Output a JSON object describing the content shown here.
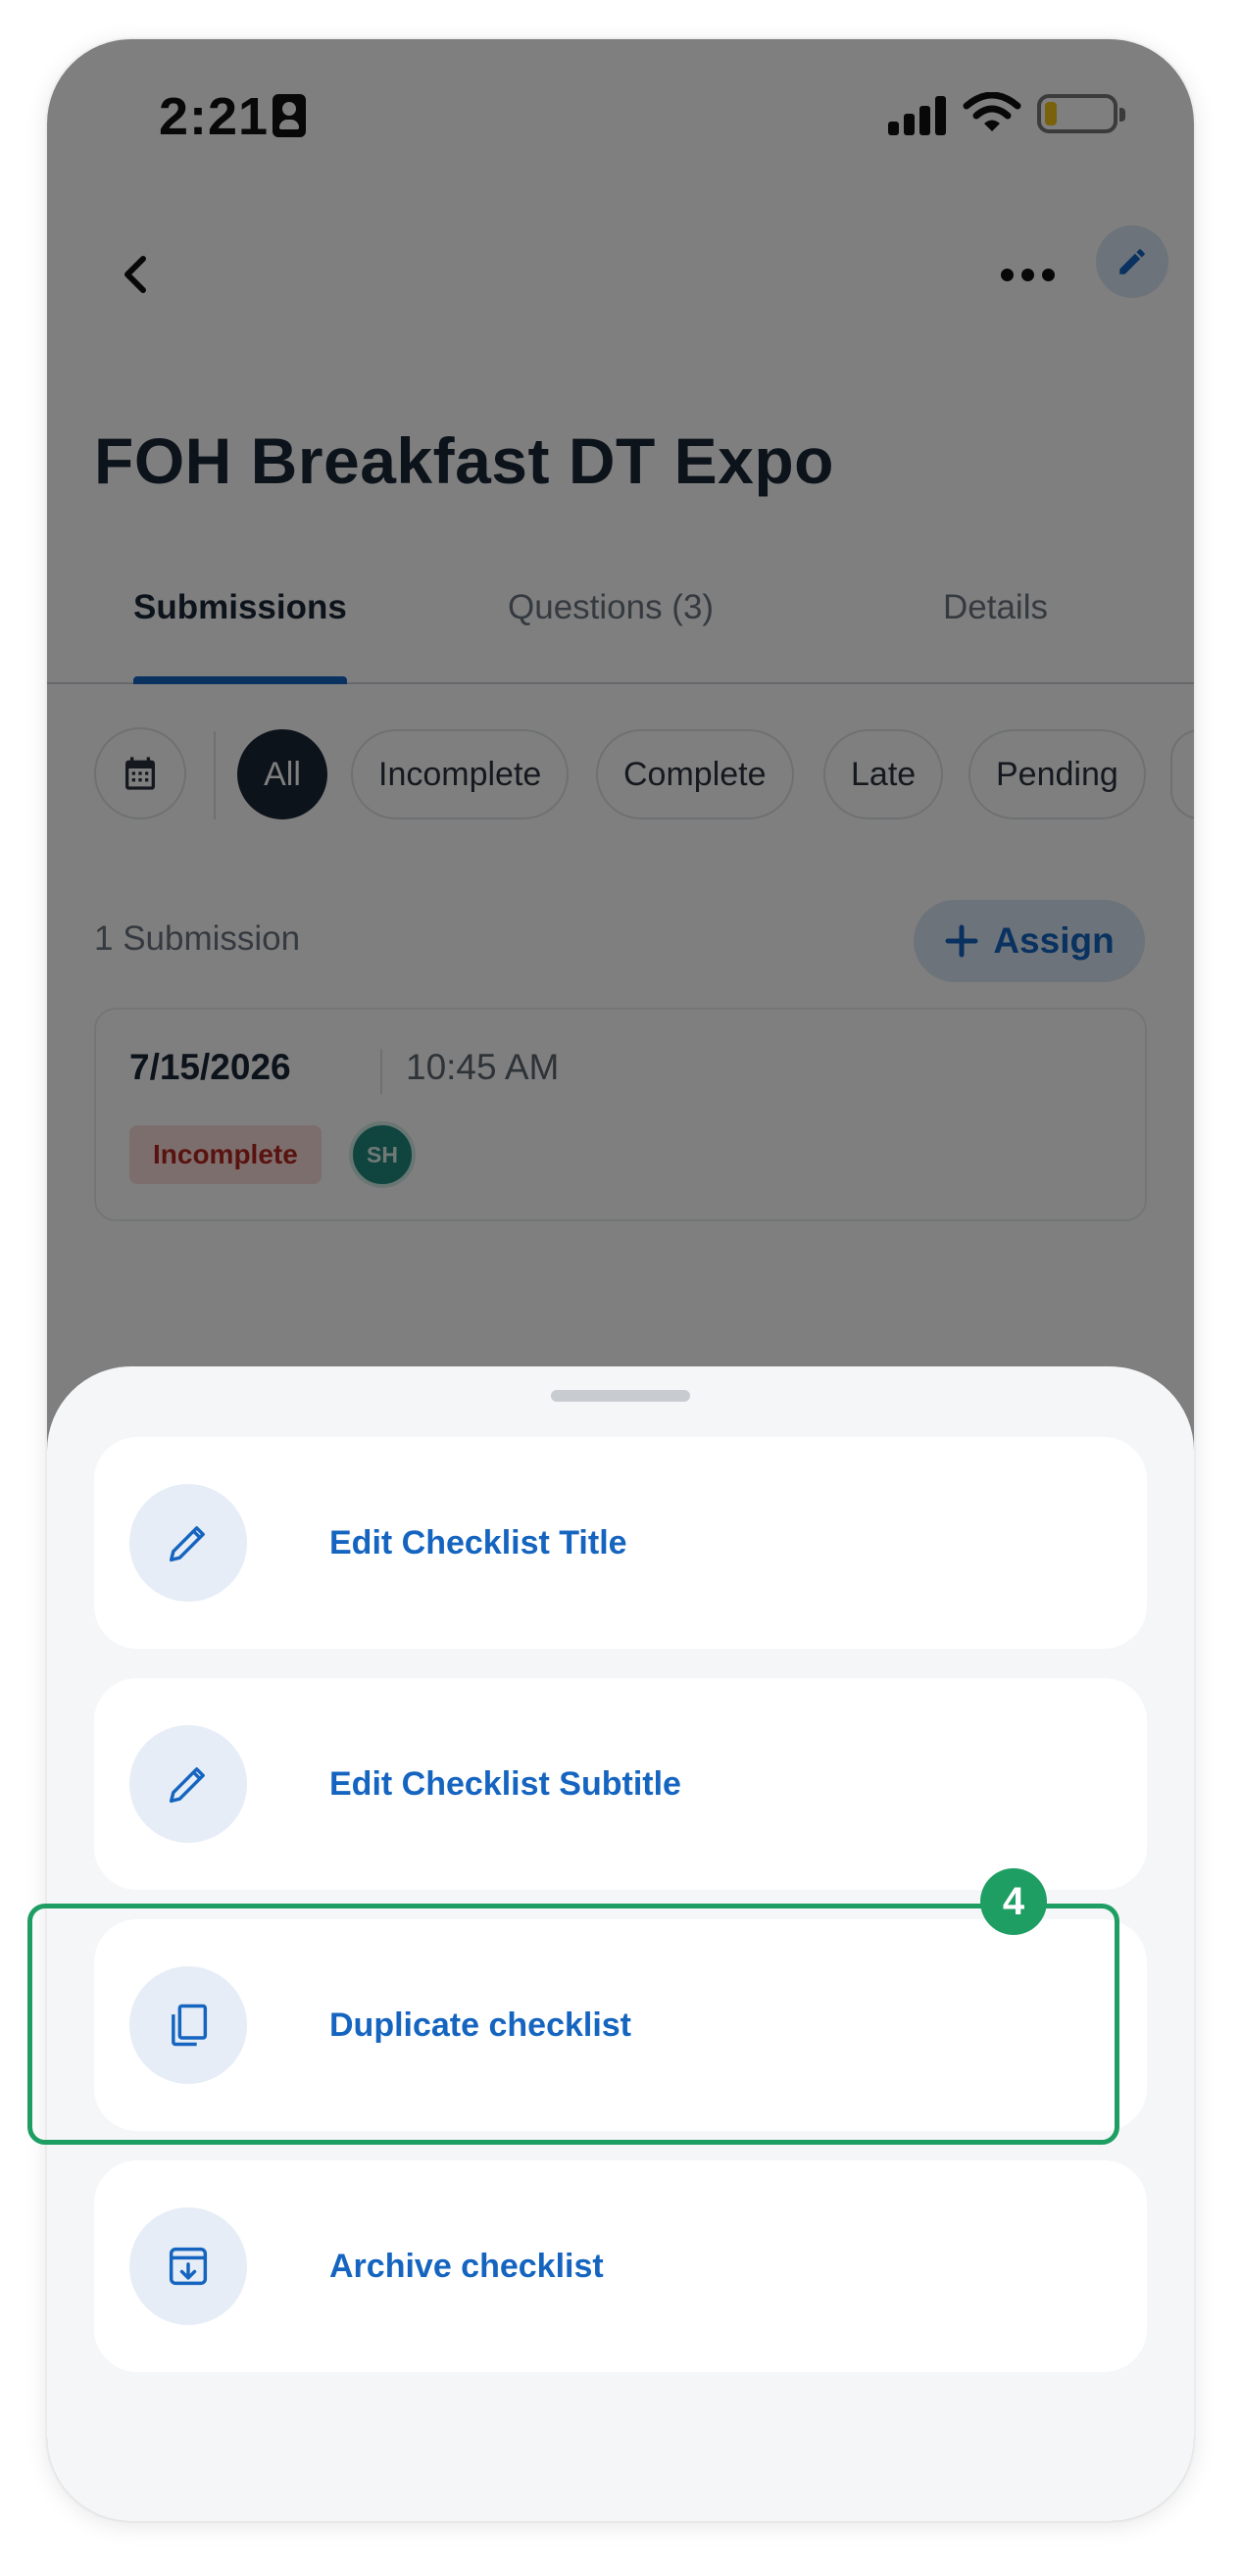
{
  "status_bar": {
    "time": "2:21"
  },
  "header": {
    "title": "FOH Breakfast DT Expo"
  },
  "tabs": [
    {
      "label": "Submissions",
      "active": true
    },
    {
      "label": "Questions (3)",
      "active": false
    },
    {
      "label": "Details",
      "active": false
    }
  ],
  "filters": {
    "chips": [
      "All",
      "Incomplete",
      "Complete",
      "Late",
      "Pending"
    ],
    "selected": "All"
  },
  "submissions": {
    "count_label": "1 Submission",
    "assign_label": "Assign",
    "items": [
      {
        "date": "7/15/2026",
        "time": "10:45 AM",
        "status": "Incomplete",
        "assignee_initials": "SH"
      }
    ]
  },
  "action_sheet": {
    "items": [
      {
        "label": "Edit Checklist Title",
        "icon": "pencil-icon"
      },
      {
        "label": "Edit Checklist Subtitle",
        "icon": "pencil-icon"
      },
      {
        "label": "Duplicate checklist",
        "icon": "copy-icon"
      },
      {
        "label": "Archive checklist",
        "icon": "archive-icon"
      }
    ]
  },
  "annotation": {
    "step_number": "4",
    "highlighted_item": "Duplicate checklist"
  },
  "colors": {
    "accent": "#1565c0",
    "highlight": "#1e9e63",
    "dark": "#1b2737",
    "danger": "#b3261e"
  }
}
